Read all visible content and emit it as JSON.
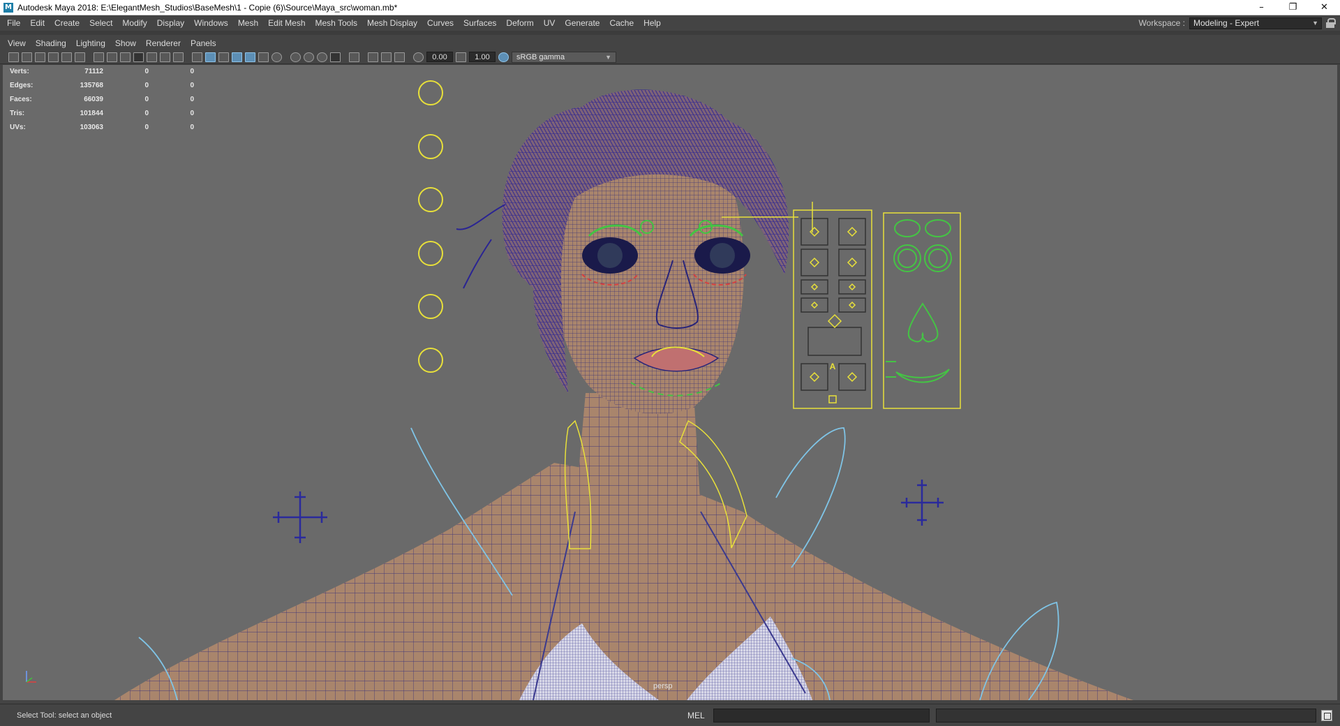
{
  "window": {
    "title": "Autodesk Maya 2018: E:\\ElegantMesh_Studios\\BaseMesh\\1 - Copie (6)\\Source\\Maya_src\\woman.mb*",
    "app_icon": "M",
    "minimize": "–",
    "maximize": "❐",
    "close": "✕"
  },
  "menu": {
    "items": [
      "File",
      "Edit",
      "Create",
      "Select",
      "Modify",
      "Display",
      "Windows",
      "Mesh",
      "Edit Mesh",
      "Mesh Tools",
      "Mesh Display",
      "Curves",
      "Surfaces",
      "Deform",
      "UV",
      "Generate",
      "Cache",
      "Help"
    ]
  },
  "workspace": {
    "label": "Workspace :",
    "value": "Modeling - Expert"
  },
  "panel_menu": {
    "items": [
      "View",
      "Shading",
      "Lighting",
      "Show",
      "Renderer",
      "Panels"
    ]
  },
  "panel_toolbar": {
    "exposure": "0.00",
    "gamma": "1.00",
    "color_space": "sRGB gamma"
  },
  "hud": {
    "rows": [
      {
        "label": "Verts:",
        "value": "71112",
        "c1": "0",
        "c2": "0"
      },
      {
        "label": "Edges:",
        "value": "135768",
        "c1": "0",
        "c2": "0"
      },
      {
        "label": "Faces:",
        "value": "66039",
        "c1": "0",
        "c2": "0"
      },
      {
        "label": "Tris:",
        "value": "101844",
        "c1": "0",
        "c2": "0"
      },
      {
        "label": "UVs:",
        "value": "103063",
        "c1": "0",
        "c2": "0"
      }
    ]
  },
  "viewport": {
    "camera": "persp",
    "facial_panel_badge": "A",
    "colors": {
      "background": "#6a6a6a",
      "skin": "#a9856c",
      "wireframe": "#28247a",
      "controls": "#e8e03a",
      "facial_controls": "#44c444",
      "curves": "#7fc4e6",
      "cross_controls": "#2a2a9c"
    }
  },
  "statusbar": {
    "help_line": "Select Tool: select an object",
    "mel": "MEL"
  }
}
